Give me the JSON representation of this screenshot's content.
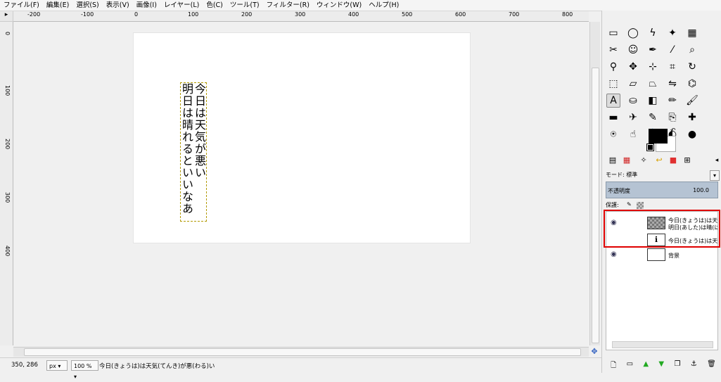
{
  "menu": [
    "ファイル(F)",
    "編集(E)",
    "選択(S)",
    "表示(V)",
    "画像(I)",
    "レイヤー(L)",
    "色(C)",
    "ツール(T)",
    "フィルター(R)",
    "ウィンドウ(W)",
    "ヘルプ(H)"
  ],
  "ruler": {
    "h_labels": [
      "-200",
      "-100",
      "0",
      "100",
      "200",
      "300",
      "400",
      "500",
      "600",
      "700",
      "800"
    ],
    "v_labels": [
      "0",
      "100",
      "200",
      "300",
      "400"
    ]
  },
  "canvas": {
    "text_col1": "今日は天気が悪い",
    "text_col2": "明日は晴れるといいなあ"
  },
  "status": {
    "coords": "350, 286",
    "unit": "px",
    "zoom": "100 %",
    "message": "今日(きょうは)は天気(てんき)が悪(わる)い"
  },
  "dock": {
    "mode_label": "モード:",
    "mode_value": "標準",
    "opacity_label": "不透明度",
    "opacity_value": "100.0",
    "lock_label": "保護:",
    "layers": [
      {
        "name_line1": "今日(きょうは)は天気",
        "name_line2": "明日(あした)は晴(は)",
        "visible": true
      },
      {
        "name_line1": "今日(きょうは)は天気",
        "name_line2": "",
        "visible": false
      },
      {
        "name_line1": "背景",
        "name_line2": "",
        "visible": true
      }
    ]
  },
  "colors": {
    "highlight": "#e00000",
    "foreground": "#000000",
    "background": "#ffffff",
    "opacity_bar": "#b5c3d3"
  },
  "tools": [
    "rect-select",
    "ellipse-select",
    "free-select",
    "fuzzy-select",
    "color-select",
    "scissors-select",
    "foreground-select",
    "paths",
    "color-picker",
    "zoom",
    "measure",
    "move",
    "align",
    "crop",
    "rotate",
    "scale",
    "shear",
    "perspective",
    "flip",
    "cage-transform",
    "text",
    "bucket-fill",
    "blend",
    "pencil",
    "paintbrush",
    "eraser",
    "airbrush",
    "ink",
    "clone",
    "heal",
    "perspective-clone",
    "smudge",
    "blur",
    "dodge-burn",
    "mypaint-brush"
  ]
}
